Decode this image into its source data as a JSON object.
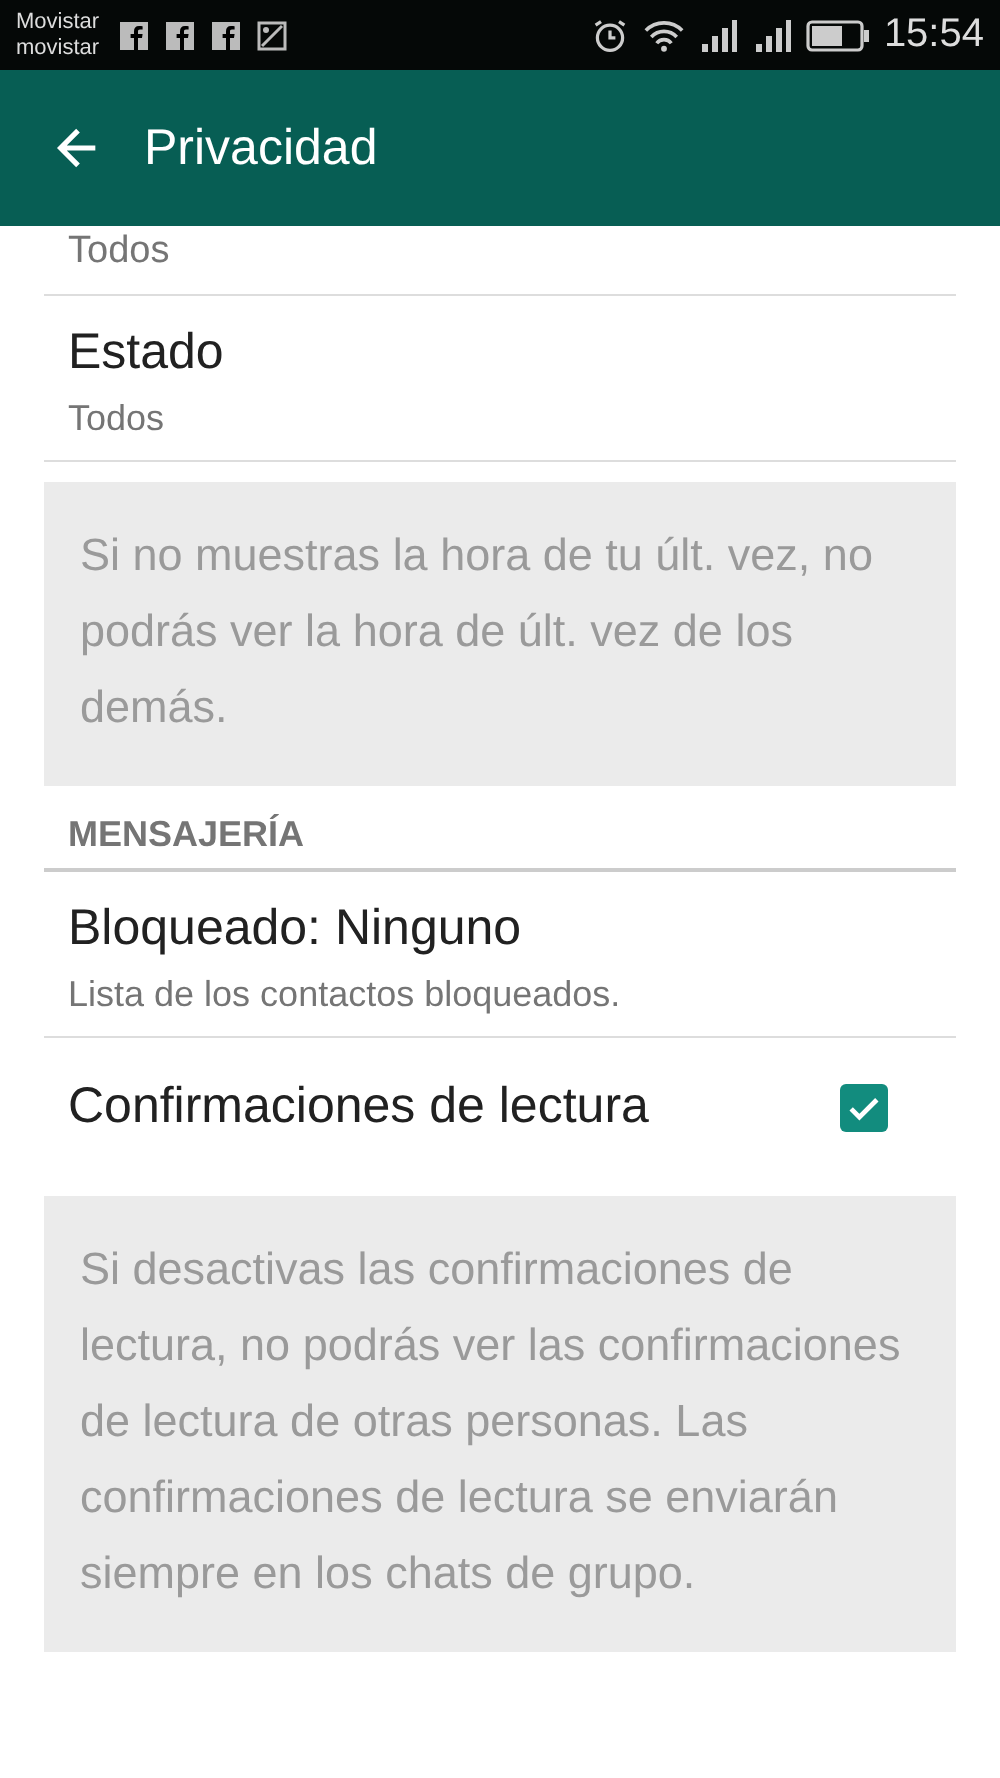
{
  "status_bar": {
    "carriers": [
      "Movistar",
      "movistar"
    ],
    "time": "15:54"
  },
  "app_bar": {
    "title": "Privacidad"
  },
  "items": [
    {
      "kind": "partial",
      "subtitle": "Todos"
    },
    {
      "kind": "setting",
      "title": "Estado",
      "subtitle": "Todos"
    },
    {
      "kind": "note",
      "text": "Si no muestras la hora de tu últ. vez, no podrás ver la hora de últ. vez de los demás."
    },
    {
      "kind": "header",
      "text": "MENSAJERÍA"
    },
    {
      "kind": "setting",
      "title": "Bloqueado: Ninguno",
      "subtitle": "Lista de los contactos bloqueados."
    },
    {
      "kind": "check",
      "title": "Confirmaciones de lectura",
      "checked": true
    },
    {
      "kind": "note",
      "text": "Si desactivas las confirmaciones de lectura, no podrás ver las confirmaciones de lectura de otras personas. Las confirmaciones de lectura se enviarán siempre en los chats de grupo."
    }
  ]
}
